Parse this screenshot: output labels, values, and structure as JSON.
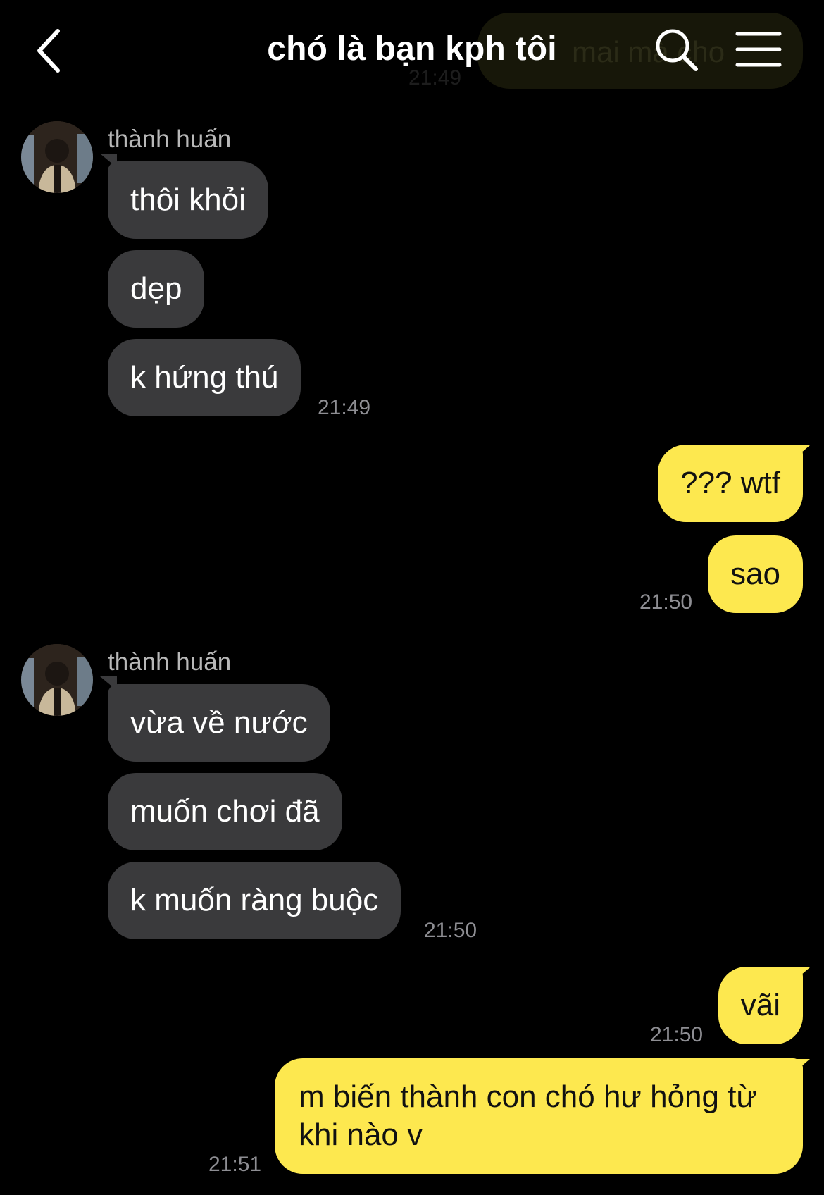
{
  "header": {
    "title": "chó là bạn kph tôi",
    "ghost_preview_text": "mai mà cho",
    "ghost_preview_time": "21:49"
  },
  "messages": [
    {
      "sender": "thành huấn",
      "direction": "in",
      "items": [
        "thôi khỏi",
        "dẹp",
        "k hứng thú"
      ],
      "time": "21:49"
    },
    {
      "direction": "out",
      "items": [
        "??? wtf",
        "sao"
      ],
      "time": "21:50"
    },
    {
      "sender": "thành huấn",
      "direction": "in",
      "items": [
        "vừa về nước",
        "muốn chơi đã",
        "k muốn ràng buộc"
      ],
      "time": "21:50"
    },
    {
      "direction": "out",
      "items": [
        "vãi"
      ],
      "time": "21:50"
    },
    {
      "direction": "out",
      "items": [
        "m biến thành con chó hư hỏng từ khi nào v"
      ],
      "time": "21:51"
    }
  ],
  "colors": {
    "background": "#000000",
    "incoming_bubble": "#3a3a3c",
    "outgoing_bubble": "#fde84f",
    "timestamp": "#8e8e93"
  },
  "icons": [
    "back-arrow-icon",
    "search-icon",
    "menu-icon"
  ]
}
